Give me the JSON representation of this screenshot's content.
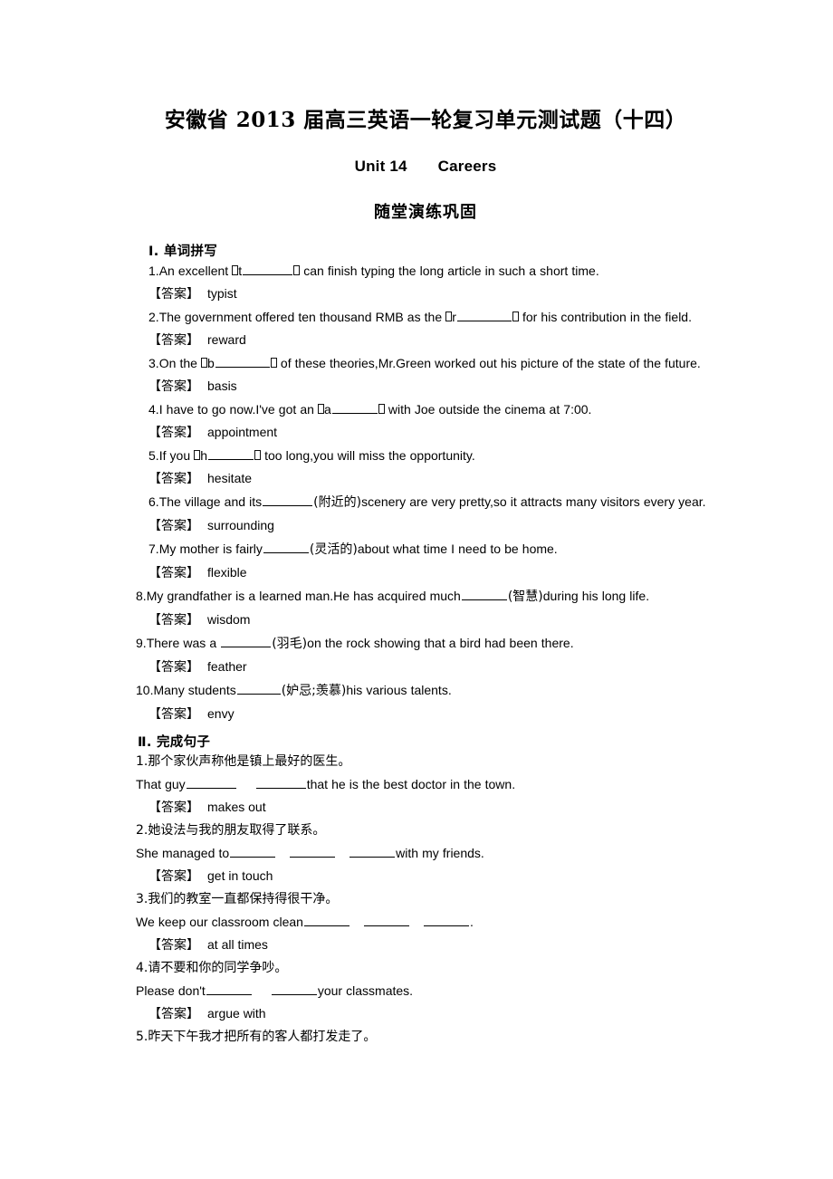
{
  "document": {
    "title": "安徽省 2013 届高三英语一轮复习单元测试题（十四）",
    "unit_label": "Unit 14",
    "unit_topic": "Careers",
    "section_title": "随堂演练巩固"
  },
  "part_one": {
    "heading": "Ⅰ. 单词拼写",
    "answer_label": "【答案】",
    "items": [
      {
        "number": "1.",
        "before": "An excellent ",
        "hint_letter": "t",
        "after": " can finish typing the long article in such a short time.",
        "answer": "typist"
      },
      {
        "number": "2.",
        "before": "The government offered ten thousand RMB as the ",
        "hint_letter": "r",
        "after": " for his contribution in the field.",
        "answer": "reward"
      },
      {
        "number": "3.",
        "before": "On the ",
        "hint_letter": "b",
        "after": " of these theories,Mr.Green worked out his picture of the state of the future.",
        "answer": "basis"
      },
      {
        "number": "4.",
        "before": "I have to go now.I've got an ",
        "hint_letter": "a",
        "after": " with Joe outside the cinema at 7:00.",
        "answer": "appointment"
      },
      {
        "number": "5.",
        "before": "If you ",
        "hint_letter": "h",
        "after": " too long,you will miss the opportunity.",
        "answer": "hesitate"
      },
      {
        "number": "6.",
        "before": "The village and its",
        "chinese_hint": "(附近的)",
        "after": "scenery are very pretty,so it attracts many visitors every year.",
        "answer": "surrounding"
      },
      {
        "number": "7.",
        "before": "My mother is fairly",
        "chinese_hint": "(灵活的)",
        "after": "about what time I need to be home.",
        "answer": "flexible"
      },
      {
        "number": "8.",
        "before": "My grandfather is a learned man.He has acquired much",
        "chinese_hint": "(智慧)",
        "after": "during his long life.",
        "answer": "wisdom"
      },
      {
        "number": "9.",
        "before": "There was a ",
        "chinese_hint": "(羽毛)",
        "after": "on the rock showing that a bird had been there.",
        "answer": "feather"
      },
      {
        "number": "10.",
        "before": "Many students",
        "chinese_hint": "(妒忌;羡慕)",
        "after": "his various talents.",
        "answer": "envy"
      }
    ]
  },
  "part_two": {
    "heading": "Ⅱ. 完成句子",
    "answer_label": "【答案】",
    "items": [
      {
        "number": "1.",
        "chinese": "那个家伙声称他是镇上最好的医生。",
        "english_before": "That guy",
        "english_after": "that he is the best doctor in the town.",
        "blanks": 2,
        "answer": "makes out"
      },
      {
        "number": "2.",
        "chinese": "她设法与我的朋友取得了联系。",
        "english_before": "She managed to",
        "english_after": "with my friends.",
        "blanks": 3,
        "answer": "get in touch"
      },
      {
        "number": "3.",
        "chinese": "我们的教室一直都保持得很干净。",
        "english_before": "We keep our classroom clean",
        "english_after": ".",
        "blanks": 3,
        "answer": "at all times"
      },
      {
        "number": "4.",
        "chinese": "请不要和你的同学争吵。",
        "english_before": "Please don't",
        "english_after": "your classmates.",
        "blanks": 2,
        "answer": "argue with"
      },
      {
        "number": "5.",
        "chinese": "昨天下午我才把所有的客人都打发走了。",
        "english_before": "",
        "english_after": "",
        "blanks": 0,
        "answer": ""
      }
    ]
  }
}
